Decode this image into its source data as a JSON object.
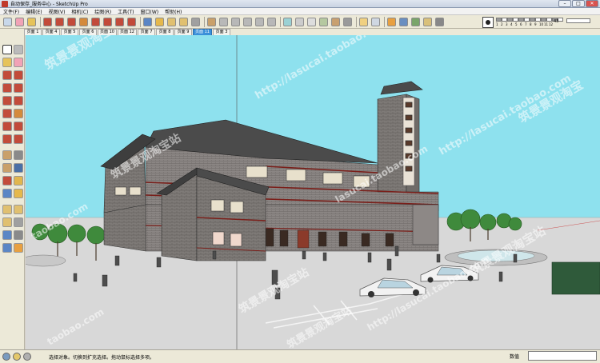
{
  "window": {
    "title": "自动保存_服务中心 - SketchUp Pro",
    "min_label": "–",
    "max_label": "□",
    "close_label": "✕"
  },
  "menu": [
    {
      "label": "文件(F)"
    },
    {
      "label": "编辑(E)"
    },
    {
      "label": "视图(V)"
    },
    {
      "label": "相机(C)"
    },
    {
      "label": "绘图(R)"
    },
    {
      "label": "工具(T)"
    },
    {
      "label": "窗口(W)"
    },
    {
      "label": "帮助(H)"
    }
  ],
  "toolbar": {
    "icons": [
      "select-icon",
      "eraser-icon",
      "paint-bucket-icon",
      "line-icon",
      "arc-icon",
      "rectangle-icon",
      "push-pull-icon",
      "move-icon",
      "rotate-icon",
      "scale-icon",
      "offset-icon",
      "orbit-icon",
      "pan-icon",
      "zoom-icon",
      "zoom-extents-icon",
      "previous-view-icon",
      "iso-view-icon",
      "top-view-icon",
      "front-view-icon",
      "right-view-icon",
      "back-view-icon",
      "left-view-icon",
      "xray-icon",
      "wireframe-icon",
      "hidden-line-icon",
      "shaded-icon",
      "textured-icon",
      "monochrome-icon",
      "shadows-icon",
      "fog-icon",
      "section-plane-icon",
      "layers-icon",
      "components-icon",
      "materials-icon",
      "styles-icon"
    ],
    "icon_colors": [
      "#c8d8ea",
      "#f1a3b6",
      "#e6c35a",
      "#c24b3a",
      "#c24b3a",
      "#c24b3a",
      "#d48a3b",
      "#c24b3a",
      "#c24b3a",
      "#c24b3a",
      "#c24b3a",
      "#5b86c5",
      "#e5b84c",
      "#e0c070",
      "#e0c070",
      "#a0a0a0",
      "#c9a06a",
      "#b8b8b8",
      "#b8b8b8",
      "#b8b8b8",
      "#b8b8b8",
      "#b8b8b8",
      "#9ad1d4",
      "#cccccc",
      "#dddddd",
      "#b5c8a0",
      "#c8a070",
      "#9a9a9a",
      "#f0d080",
      "#cfd7e2",
      "#e8a040",
      "#6a8fc0",
      "#7aa56a",
      "#d9c07a",
      "#888888"
    ],
    "scale_ticks": [
      "1",
      "2",
      "3",
      "4",
      "5",
      "6",
      "7",
      "8",
      "9",
      "10",
      "11",
      "12"
    ],
    "scale_value": "43"
  },
  "scene_tabs": [
    {
      "label": "页面 1",
      "active": false
    },
    {
      "label": "页面 4",
      "active": false
    },
    {
      "label": "页面 5",
      "active": false
    },
    {
      "label": "页面 6",
      "active": false
    },
    {
      "label": "页面 10",
      "active": false
    },
    {
      "label": "页面 12",
      "active": false
    },
    {
      "label": "页面 7",
      "active": false
    },
    {
      "label": "页面 8",
      "active": false
    },
    {
      "label": "页面 9",
      "active": false
    },
    {
      "label": "页面 11",
      "active": true
    },
    {
      "label": "页面 3",
      "active": false
    }
  ],
  "left_tools": {
    "icons": [
      "select-icon",
      "make-component-icon",
      "paint-bucket-icon",
      "eraser-icon",
      "rectangle-icon",
      "line-icon",
      "circle-icon",
      "arc-icon",
      "polygon-icon",
      "freehand-icon",
      "move-icon",
      "push-pull-icon",
      "rotate-icon",
      "follow-me-icon",
      "scale-icon",
      "offset-icon",
      "tape-measure-icon",
      "dimension-icon",
      "protractor-icon",
      "text-icon",
      "axes-icon",
      "3d-text-icon",
      "orbit-icon",
      "pan-icon",
      "zoom-icon",
      "zoom-window-icon",
      "zoom-extents-icon",
      "previous-icon",
      "position-camera-icon",
      "walk-icon",
      "look-around-icon",
      "section-plane-icon"
    ],
    "icon_colors": [
      "#ffffff",
      "#bbbbbb",
      "#e6c35a",
      "#f1a3b6",
      "#c24b3a",
      "#c24b3a",
      "#c24b3a",
      "#c24b3a",
      "#c24b3a",
      "#c24b3a",
      "#c24b3a",
      "#d48a3b",
      "#c24b3a",
      "#c24b3a",
      "#c24b3a",
      "#c24b3a",
      "#c9a06a",
      "#8a8a8a",
      "#c9a06a",
      "#4a6fa5",
      "#c24b3a",
      "#e1b64f",
      "#5b86c5",
      "#e5b84c",
      "#e0c070",
      "#e0c070",
      "#e0c070",
      "#a0a0a0",
      "#5b86c5",
      "#8a8a8a",
      "#5b86c5",
      "#e8a040"
    ]
  },
  "watermarks": [
    {
      "text": "筑景景观淘宝"
    },
    {
      "text": "http://lasucai.taobao.com"
    },
    {
      "text": "筑景景观淘宝"
    },
    {
      "text": "taobao.com"
    },
    {
      "text": "筑景景观淘宝站"
    },
    {
      "text": "http://lasucai.taobao.com"
    },
    {
      "text": "筑景景观淘宝站"
    },
    {
      "text": "lasucai.taobao.com"
    },
    {
      "text": "http://lasucai.taobao.com"
    },
    {
      "text": "筑景景观淘宝站"
    },
    {
      "text": "taobao.com"
    },
    {
      "text": "筑景景观淘宝站"
    }
  ],
  "statusbar": {
    "message": "选择对象。切换到扩充选择。拖动鼠标选择多项。",
    "vcb_label": "数值",
    "vcb_value": ""
  },
  "colors": {
    "sky": "#8ee1ee",
    "ground": "#d8d8d8",
    "brick": "#7e7a77",
    "roof": "#4b4b4b",
    "accent_red": "#a8322a",
    "active_tab": "#3a8fd9"
  }
}
